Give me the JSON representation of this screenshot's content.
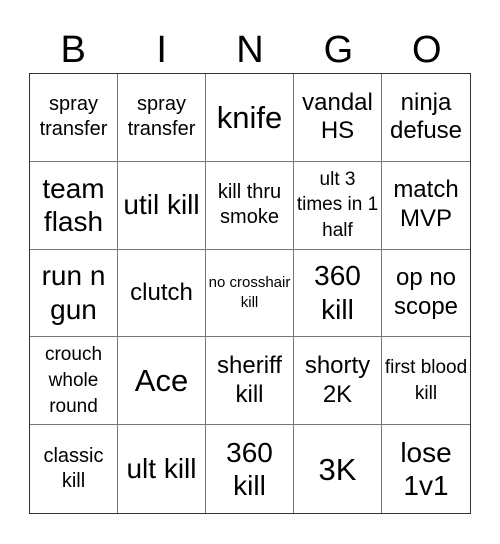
{
  "header": {
    "letters": [
      "B",
      "I",
      "N",
      "G",
      "O"
    ]
  },
  "cells": [
    {
      "text": "spray transfer",
      "size": "s4"
    },
    {
      "text": "spray transfer",
      "size": "s4"
    },
    {
      "text": "knife",
      "size": "s1"
    },
    {
      "text": "vandal HS",
      "size": "s3"
    },
    {
      "text": "ninja defuse",
      "size": "s3"
    },
    {
      "text": "team flash",
      "size": "s2"
    },
    {
      "text": "util kill",
      "size": "s2"
    },
    {
      "text": "kill thru smoke",
      "size": "s4"
    },
    {
      "text": "ult 3 times in 1 half",
      "size": "s5"
    },
    {
      "text": "match MVP",
      "size": "s3"
    },
    {
      "text": "run n gun",
      "size": "s2"
    },
    {
      "text": "clutch",
      "size": "s3"
    },
    {
      "text": "no crosshair kill",
      "size": "s6"
    },
    {
      "text": "360 kill",
      "size": "s2"
    },
    {
      "text": "op no scope",
      "size": "s3"
    },
    {
      "text": "crouch whole round",
      "size": "s5"
    },
    {
      "text": "Ace",
      "size": "s1"
    },
    {
      "text": "sheriff kill",
      "size": "s3"
    },
    {
      "text": "shorty 2K",
      "size": "s3"
    },
    {
      "text": "first blood kill",
      "size": "s5"
    },
    {
      "text": "classic kill",
      "size": "s4"
    },
    {
      "text": "ult kill",
      "size": "s2"
    },
    {
      "text": "360 kill",
      "size": "s2"
    },
    {
      "text": "3K",
      "size": "s1"
    },
    {
      "text": "lose 1v1",
      "size": "s2"
    }
  ]
}
